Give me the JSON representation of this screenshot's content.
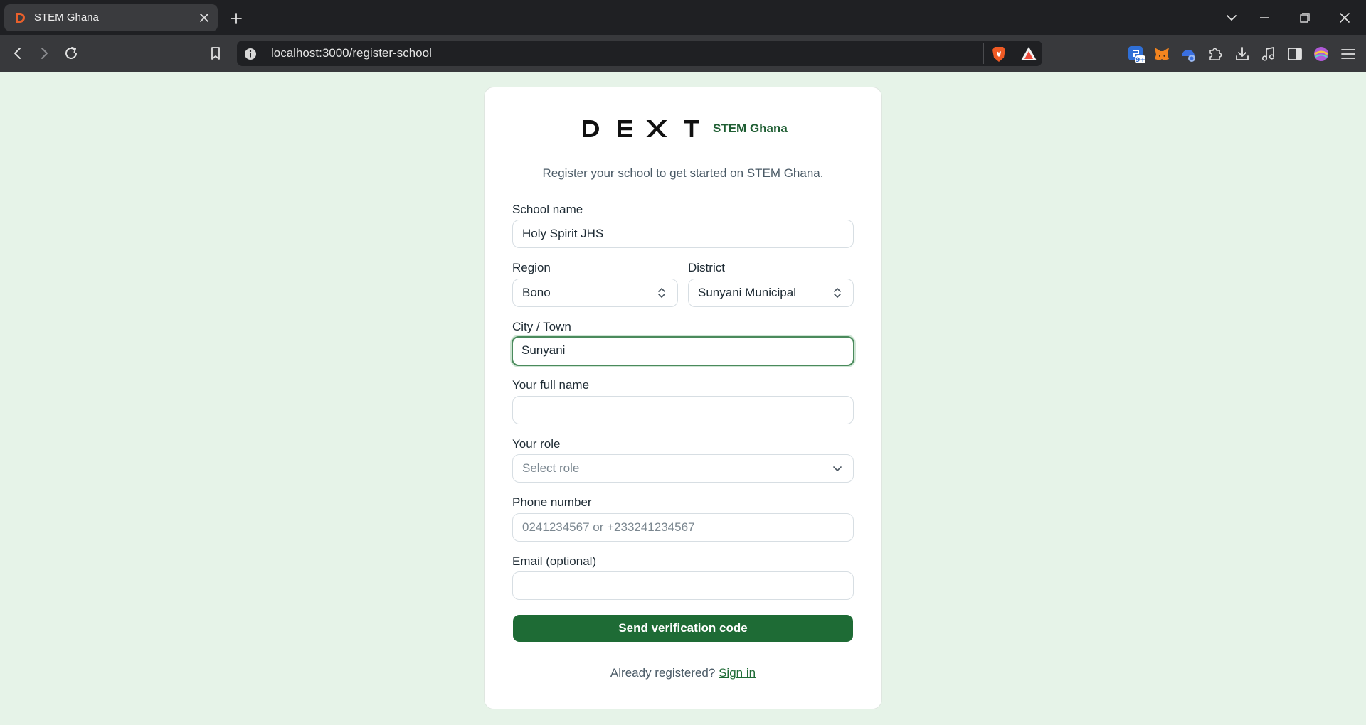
{
  "browser": {
    "tab_title": "STEM Ghana",
    "url": "localhost:3000/register-school"
  },
  "brand": {
    "logo_text": "DEXT",
    "name": "STEM Ghana"
  },
  "form": {
    "subtitle": "Register your school to get started on STEM Ghana.",
    "school_name": {
      "label": "School name",
      "value": "Holy Spirit JHS"
    },
    "region": {
      "label": "Region",
      "value": "Bono"
    },
    "district": {
      "label": "District",
      "value": "Sunyani Municipal"
    },
    "city": {
      "label": "City / Town",
      "value": "Sunyani"
    },
    "full_name": {
      "label": "Your full name",
      "value": ""
    },
    "role": {
      "label": "Your role",
      "placeholder": "Select role"
    },
    "phone": {
      "label": "Phone number",
      "placeholder": "0241234567 or +233241234567"
    },
    "email": {
      "label": "Email (optional)",
      "value": ""
    },
    "submit_label": "Send verification code",
    "footer_text": "Already registered?",
    "signin_label": "Sign in"
  },
  "colors": {
    "page_bg": "#e6f3e8",
    "accent": "#1e6b35",
    "brand_text": "#1f5e33"
  }
}
